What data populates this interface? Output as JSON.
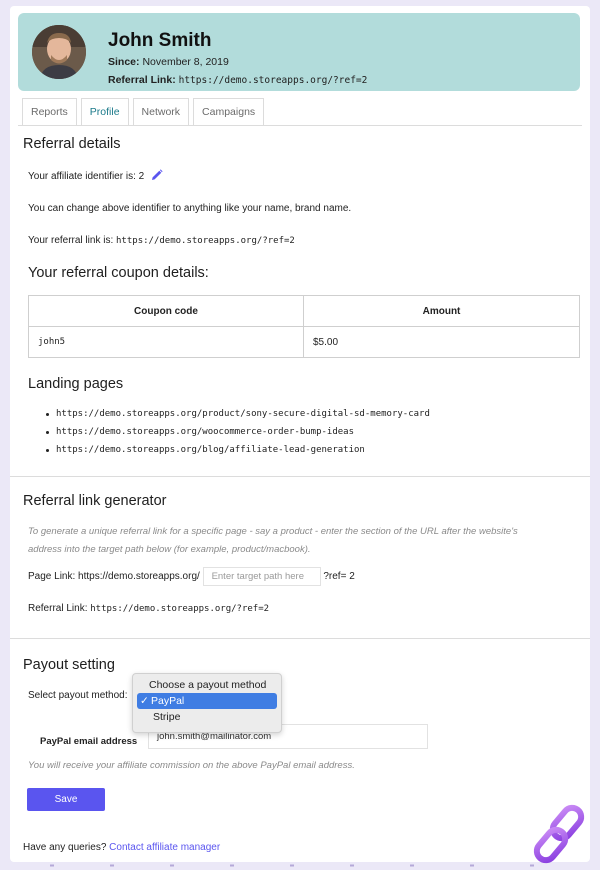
{
  "profile": {
    "name": "John Smith",
    "since_label": "Since:",
    "since_value": "November 8, 2019",
    "referral_label": "Referral Link:",
    "referral_url": "https://demo.storeapps.org/?ref=2"
  },
  "tabs": [
    {
      "label": "Reports",
      "active": false
    },
    {
      "label": "Profile",
      "active": true
    },
    {
      "label": "Network",
      "active": false
    },
    {
      "label": "Campaigns",
      "active": false
    }
  ],
  "referral_details": {
    "heading": "Referral details",
    "identifier_text": "Your affiliate identifier is:",
    "identifier_value": "2",
    "change_note": "You can change above identifier to anything like your name, brand name.",
    "link_text": "Your referral link is:",
    "link_value": "https://demo.storeapps.org/?ref=2"
  },
  "coupon": {
    "heading": "Your referral coupon details:",
    "columns": [
      "Coupon code",
      "Amount"
    ],
    "rows": [
      {
        "code": "john5",
        "amount": "$5.00"
      }
    ]
  },
  "landing": {
    "heading": "Landing pages",
    "items": [
      "https://demo.storeapps.org/product/sony-secure-digital-sd-memory-card",
      "https://demo.storeapps.org/woocommerce-order-bump-ideas",
      "https://demo.storeapps.org/blog/affiliate-lead-generation"
    ]
  },
  "generator": {
    "heading": "Referral link generator",
    "hint_line1": "To generate a unique referral link for a specific page - say a product - enter the section of the URL after the website's",
    "hint_line2": "address into the target path below (for example, product/macbook).",
    "page_link_label": "Page Link:",
    "page_link_base": "https://demo.storeapps.org/",
    "target_placeholder": "Enter target path here",
    "page_link_suffix": "?ref= 2",
    "referral_link_label": "Referral Link:",
    "referral_link_value": "https://demo.storeapps.org/?ref=2"
  },
  "payout": {
    "heading": "Payout setting",
    "select_label": "Select payout method:",
    "options": [
      "Choose a payout method",
      "PayPal",
      "Stripe"
    ],
    "selected": "PayPal",
    "email_label": "PayPal email address",
    "email_value": "john.smith@mailinator.com",
    "email_note": "You will receive your affiliate commission on the above PayPal email address.",
    "save_label": "Save"
  },
  "footer": {
    "queries_text": "Have any queries?",
    "contact_link": "Contact affiliate manager"
  },
  "colors": {
    "header_bg": "#b2dcdb",
    "accent": "#5a55ef",
    "active_tab": "#1b7a8a",
    "selected_option": "#3f7de3"
  },
  "icons": [
    "edit-pencil-icon",
    "checkmark-icon",
    "chain-link-icon"
  ]
}
